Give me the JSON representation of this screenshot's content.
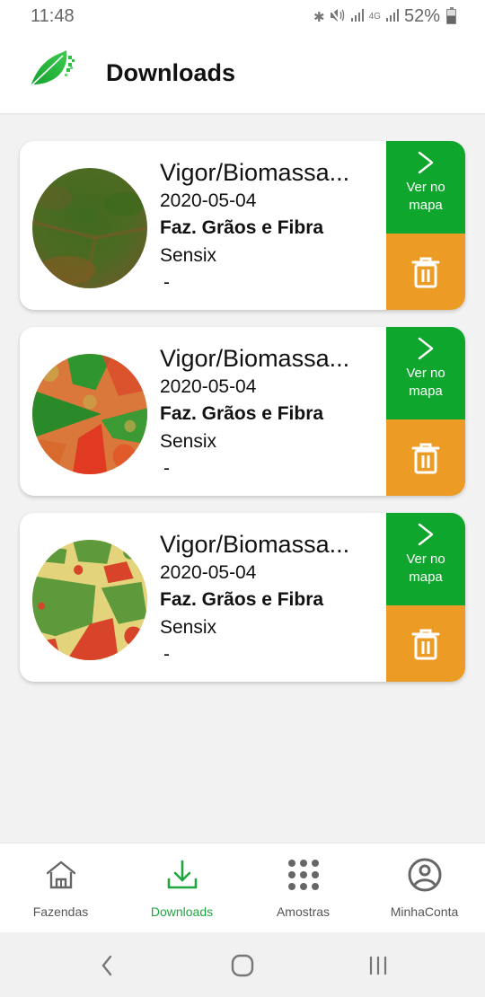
{
  "status_bar": {
    "time": "11:48",
    "icons": [
      "bluetooth-icon",
      "mute-icon",
      "signal-icon",
      "4g-icon",
      "signal-icon"
    ],
    "network_label": "4G",
    "battery": "52%"
  },
  "header": {
    "logo": "leaf-logo-icon",
    "title": "Downloads"
  },
  "colors": {
    "primary_green": "#0ea62c",
    "delete_orange": "#ec9b25",
    "active_nav": "#1fa640"
  },
  "downloads": [
    {
      "title": "Vigor/Biomassa...",
      "date": "2020-05-04",
      "farm": "Faz. Grãos e Fibra",
      "company": "Sensix",
      "extra": "-",
      "thumbnail": "rgb-satellite",
      "view_label": "Ver no mapa",
      "view_icon": "chevron-right-icon",
      "delete_icon": "trash-icon"
    },
    {
      "title": "Vigor/Biomassa...",
      "date": "2020-05-04",
      "farm": "Faz. Grãos e Fibra",
      "company": "Sensix",
      "extra": "-",
      "thumbnail": "ndvi-gradient",
      "view_label": "Ver no mapa",
      "view_icon": "chevron-right-icon",
      "delete_icon": "trash-icon"
    },
    {
      "title": "Vigor/Biomassa...",
      "date": "2020-05-04",
      "farm": "Faz. Grãos e Fibra",
      "company": "Sensix",
      "extra": "-",
      "thumbnail": "ndvi-classified",
      "view_label": "Ver no mapa",
      "view_icon": "chevron-right-icon",
      "delete_icon": "trash-icon"
    }
  ],
  "bottom_nav": {
    "items": [
      {
        "label": "Fazendas",
        "icon": "home-icon",
        "active": false
      },
      {
        "label": "Downloads",
        "icon": "download-icon",
        "active": true
      },
      {
        "label": "Amostras",
        "icon": "grid-dots-icon",
        "active": false
      },
      {
        "label": "MinhaConta",
        "icon": "account-circle-icon",
        "active": false
      }
    ]
  },
  "system_nav": {
    "buttons": [
      "back-icon",
      "home-circle-icon",
      "recents-icon"
    ]
  }
}
